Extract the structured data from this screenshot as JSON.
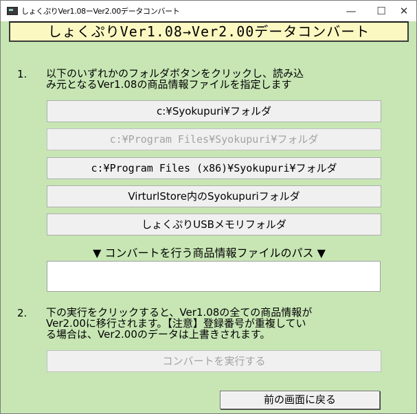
{
  "window": {
    "title": "しょくぷりVer1.08ーVer2.00データコンバート",
    "controls": {
      "minimize": "—",
      "maximize": "☐",
      "close": "✕"
    }
  },
  "header": {
    "banner": "しょくぷりVer1.08→Ver2.00データコンバート"
  },
  "step1": {
    "num": "1.",
    "line1": "以下のいずれかのフォルダボタンをクリックし、読み込",
    "line2": "み元となるVer1.08の商品情報ファイルを指定します"
  },
  "folder_buttons": [
    {
      "label": "c:¥Syokupuri¥フォルダ",
      "enabled": true
    },
    {
      "label": "c:¥Program Files¥Syokupuri¥フォルダ",
      "enabled": false
    },
    {
      "label": "c:¥Program Files (x86)¥Syokupuri¥フォルダ",
      "enabled": true
    },
    {
      "label": "VirturlStore内のSyokupuriフォルダ",
      "enabled": true
    },
    {
      "label": "しょくぷりUSBメモリフォルダ",
      "enabled": true
    }
  ],
  "path": {
    "label": "▼ コンバートを行う商品情報ファイルのパス ▼",
    "value": ""
  },
  "step2": {
    "num": "2.",
    "line1": "下の実行をクリックすると、Ver1.08の全ての商品情報が",
    "line2": "Ver2.00に移行されます。【注意】登録番号が重複してい",
    "line3": "る場合は、Ver2.00のデータは上書きされます。"
  },
  "convert_button": {
    "label": "コンバートを実行する",
    "enabled": false
  },
  "back_button": {
    "label": "前の画面に戻る"
  },
  "colors": {
    "background": "#c7e6b4",
    "banner": "#fbf8c1"
  }
}
